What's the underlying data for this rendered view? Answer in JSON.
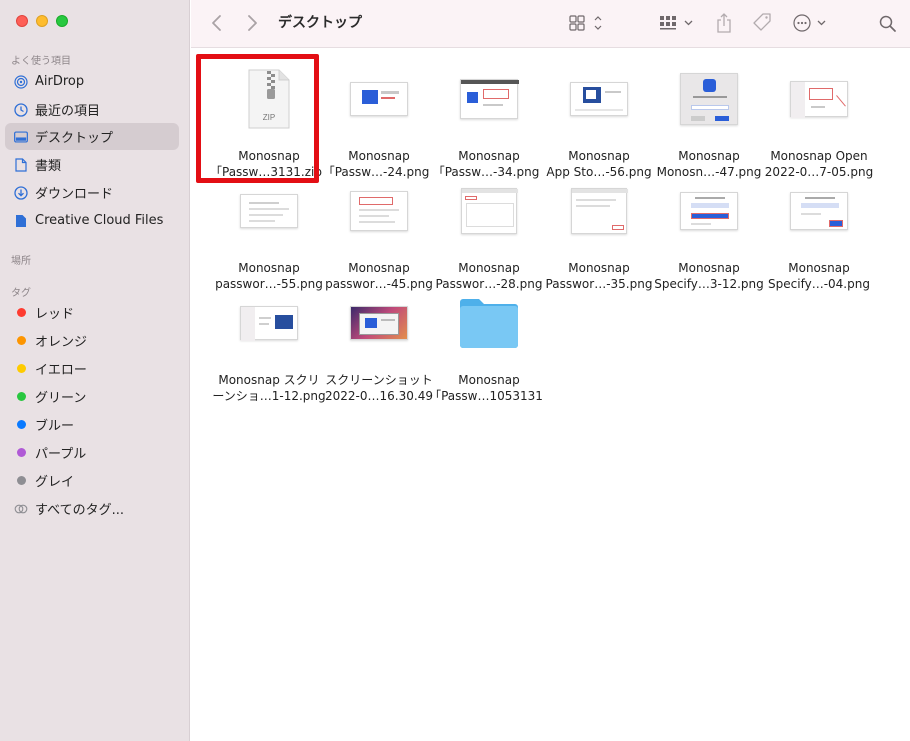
{
  "window": {
    "title": "デスクトップ"
  },
  "sidebar": {
    "favorites_title": "よく使う項目",
    "locations_title": "場所",
    "tags_title": "タグ",
    "favorites": [
      {
        "label": "AirDrop",
        "icon": "airdrop-icon"
      },
      {
        "label": "最近の項目",
        "icon": "recents-clock-icon"
      },
      {
        "label": "デスクトップ",
        "icon": "desktop-icon",
        "selected": true
      },
      {
        "label": "書類",
        "icon": "document-icon"
      },
      {
        "label": "ダウンロード",
        "icon": "download-icon"
      },
      {
        "label": "Creative Cloud Files",
        "icon": "file-icon"
      }
    ],
    "tags": [
      {
        "label": "レッド",
        "color": "#fe3b30"
      },
      {
        "label": "オレンジ",
        "color": "#fd9500"
      },
      {
        "label": "イエロー",
        "color": "#fecb00"
      },
      {
        "label": "グリーン",
        "color": "#29c740"
      },
      {
        "label": "ブルー",
        "color": "#0a7aff"
      },
      {
        "label": "パープル",
        "color": "#b05ad6"
      },
      {
        "label": "グレイ",
        "color": "#8e8e93"
      }
    ],
    "all_tags_label": "すべてのタグ..."
  },
  "toolbar": {
    "icons": [
      "back-icon",
      "forward-icon",
      "view-grid-icon",
      "group-icon",
      "share-icon",
      "tag-icon",
      "more-icon",
      "search-icon"
    ]
  },
  "files": [
    {
      "line1": "Monosnap",
      "line2": "｢Passw…3131.zip",
      "kind": "zip",
      "badge": "ZIP",
      "selected_highlight": true
    },
    {
      "line1": "Monosnap",
      "line2": "｢Passw…-24.png",
      "kind": "shot"
    },
    {
      "line1": "Monosnap",
      "line2": "｢Passw…-34.png",
      "kind": "shot"
    },
    {
      "line1": "Monosnap",
      "line2": "App Sto…-56.png",
      "kind": "shot"
    },
    {
      "line1": "Monosnap",
      "line2": "Monosn…-47.png",
      "kind": "shot"
    },
    {
      "line1": "Monosnap Open",
      "line2": "2022-0…7-05.png",
      "kind": "shot"
    },
    {
      "line1": "Monosnap",
      "line2": "passwor…-55.png",
      "kind": "shot"
    },
    {
      "line1": "Monosnap",
      "line2": "passwor…-45.png",
      "kind": "shot"
    },
    {
      "line1": "Monosnap",
      "line2": "Passwor…-28.png",
      "kind": "shot"
    },
    {
      "line1": "Monosnap",
      "line2": "Passwor…-35.png",
      "kind": "shot"
    },
    {
      "line1": "Monosnap",
      "line2": "Specify…3-12.png",
      "kind": "shot"
    },
    {
      "line1": "Monosnap",
      "line2": "Specify…-04.png",
      "kind": "shot"
    },
    {
      "line1": "Monosnap スクリ",
      "line2": "ーンショ…1-12.png",
      "kind": "shot"
    },
    {
      "line1": "スクリーンショット",
      "line2": "2022-0…16.30.49",
      "kind": "shot"
    },
    {
      "line1": "Monosnap",
      "line2": "｢Passw…1053131",
      "kind": "folder"
    }
  ]
}
